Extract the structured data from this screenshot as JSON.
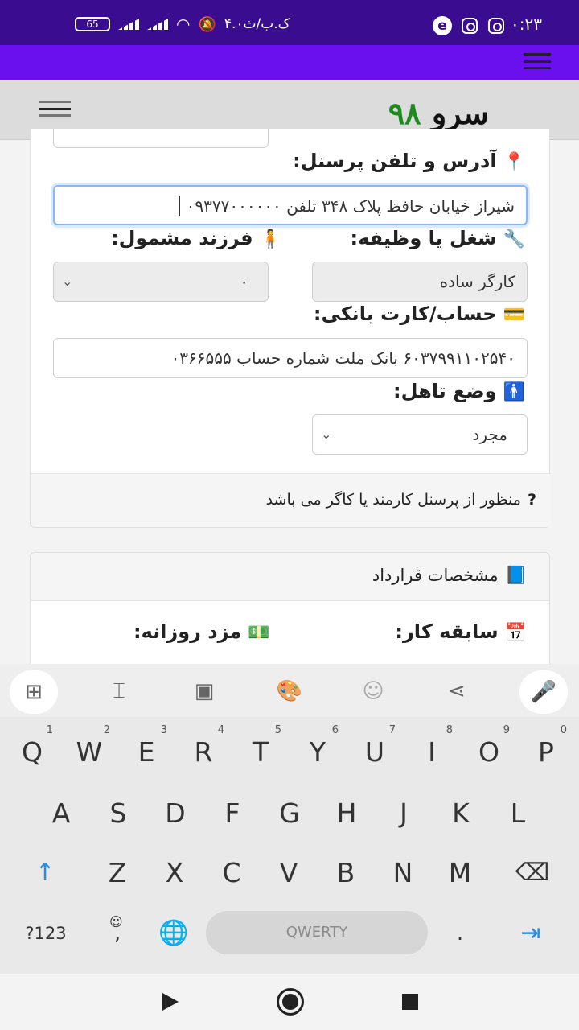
{
  "status_bar": {
    "time": "۰:۲۳",
    "network_text": "۴.۰ک.ب/ث",
    "battery": "65",
    "icons": [
      "instagram-icon",
      "instagram-icon",
      "e-app-icon",
      "wifi-icon",
      "signal-icon",
      "silent-bell-icon"
    ]
  },
  "header": {
    "logo_word": "سرو",
    "logo_number": "۹۸"
  },
  "personnel_form": {
    "address_label": "آدرس و تلفن پرسنل:",
    "address_value": "شیراز خیابان حافظ پلاک ۳۴۸ تلفن ۰۹۳۷۷۰۰۰۰۰۰",
    "job_label": "شغل یا وظیفه:",
    "job_value": "کارگر ساده",
    "children_label": "فرزند مشمول:",
    "children_value": "۰",
    "bank_label": "حساب/کارت بانکی:",
    "bank_value": "۶۰۳۷۹۹۱۱۰۲۵۴۰ بانک ملت شماره حساب ۰۳۶۶۵۵۵",
    "marital_label": "وضع تاهل:",
    "marital_value": "مجرد",
    "help_note": "منظور از پرسنل کارمند یا کاگر می باشد"
  },
  "contract_card": {
    "title": "مشخصات قرارداد",
    "experience_label": "سابقه کار:",
    "daily_wage_label": "مزد روزانه:"
  },
  "keyboard": {
    "row1": [
      {
        "k": "Q",
        "n": "1"
      },
      {
        "k": "W",
        "n": "2"
      },
      {
        "k": "E",
        "n": "3"
      },
      {
        "k": "R",
        "n": "4"
      },
      {
        "k": "T",
        "n": "5"
      },
      {
        "k": "Y",
        "n": "6"
      },
      {
        "k": "U",
        "n": "7"
      },
      {
        "k": "I",
        "n": "8"
      },
      {
        "k": "O",
        "n": "9"
      },
      {
        "k": "P",
        "n": "0"
      }
    ],
    "row2": [
      "A",
      "S",
      "D",
      "F",
      "G",
      "H",
      "J",
      "K",
      "L"
    ],
    "row3": [
      "Z",
      "X",
      "C",
      "V",
      "B",
      "N",
      "M"
    ],
    "symbols_label": "?123",
    "comma": ",",
    "period": ".",
    "space_label": "QWERTY"
  }
}
